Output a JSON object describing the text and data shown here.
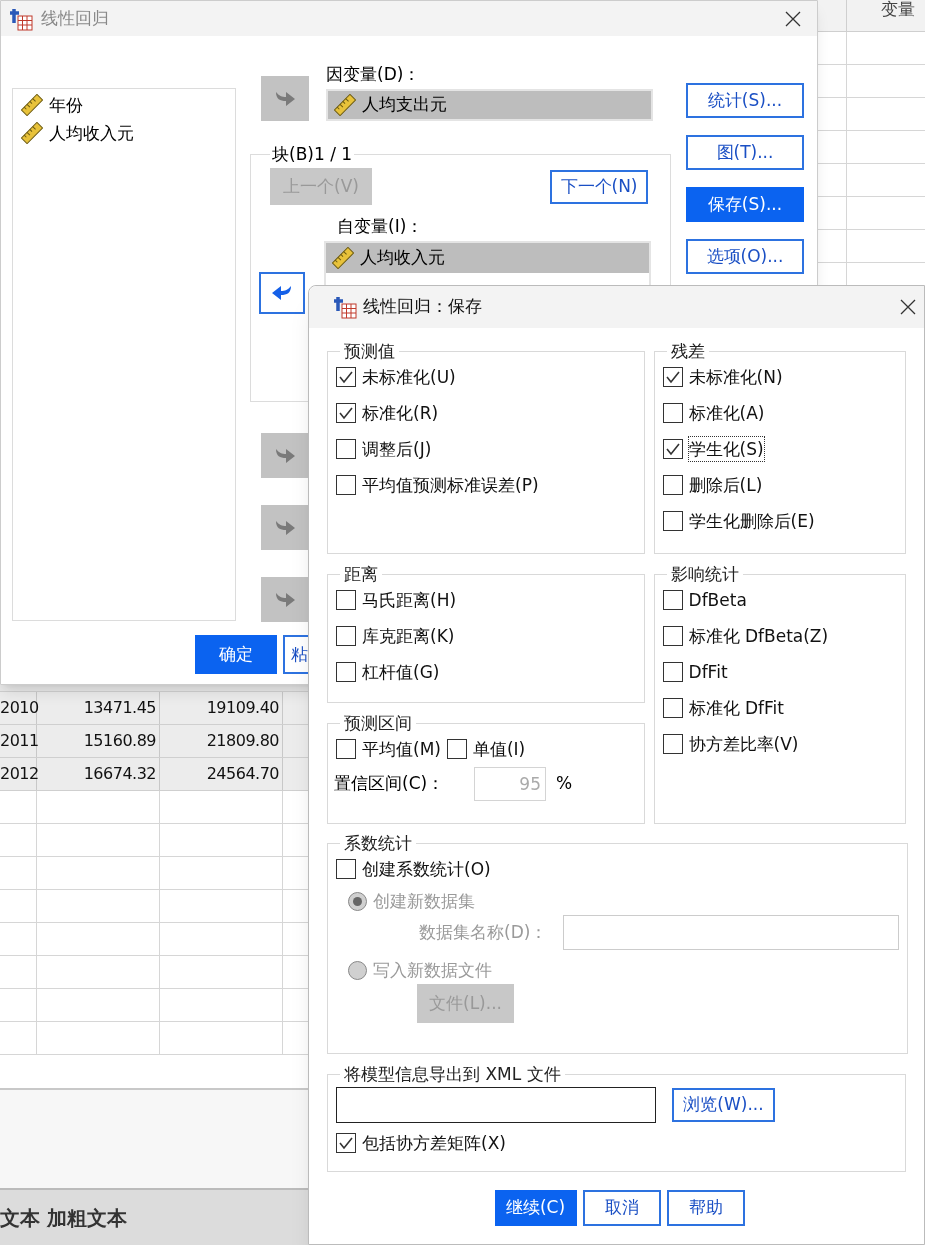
{
  "sheet_top": {
    "header": "变量"
  },
  "sheet": {
    "rows": [
      {
        "cells": [
          "2010",
          "13471.45",
          "19109.40"
        ]
      },
      {
        "cells": [
          "2011",
          "15160.89",
          "21809.80"
        ]
      },
      {
        "cells": [
          "2012",
          "16674.32",
          "24564.70"
        ]
      }
    ],
    "status_text": "文本 加粗文本"
  },
  "main_dialog": {
    "title": "线性回归",
    "variables": [
      "年份",
      "人均收入元"
    ],
    "dependent_label": "因变量(D)：",
    "dependent": [
      "人均支出元"
    ],
    "block_label": "块(B)1 / 1",
    "block_buttons": [
      {
        "label": "上一个(V)",
        "disabled": true
      },
      {
        "label": "下一个(N)",
        "disabled": false
      }
    ],
    "independent_label": "自变量(I)：",
    "independent": [
      "人均收入元"
    ],
    "side_buttons": [
      {
        "label": "统计(S)...",
        "selected": false
      },
      {
        "label": "图(T)...",
        "selected": false
      },
      {
        "label": "保存(S)...",
        "selected": true
      },
      {
        "label": "选项(O)...",
        "selected": false
      }
    ],
    "bottom_buttons": [
      {
        "label": "确定",
        "selected": true
      },
      {
        "label": "粘",
        "selected": false
      }
    ]
  },
  "save_dialog": {
    "title": "线性回归：保存",
    "predicted": {
      "title": "预测值",
      "items": [
        {
          "label": "未标准化(U)",
          "checked": true,
          "focused": false
        },
        {
          "label": "标准化(R)",
          "checked": true,
          "focused": false
        },
        {
          "label": "调整后(J)",
          "checked": false,
          "focused": false
        },
        {
          "label": "平均值预测标准误差(P)",
          "checked": false,
          "focused": false
        }
      ]
    },
    "distances": {
      "title": "距离",
      "items": [
        {
          "label": "马氏距离(H)",
          "checked": false,
          "focused": false
        },
        {
          "label": "库克距离(K)",
          "checked": false,
          "focused": false
        },
        {
          "label": "杠杆值(G)",
          "checked": false,
          "focused": false
        }
      ]
    },
    "interval": {
      "title": "预测区间",
      "items": [
        {
          "label": "平均值(M)",
          "checked": false,
          "focused": false
        },
        {
          "label": "单值(I)",
          "checked": false,
          "focused": false
        }
      ],
      "confidence": {
        "label": "置信区间(C)：",
        "value": "95",
        "disabled": true,
        "unit": "%"
      }
    },
    "residuals": {
      "title": "残差",
      "items": [
        {
          "label": "未标准化(N)",
          "checked": true,
          "focused": false
        },
        {
          "label": "标准化(A)",
          "checked": false,
          "focused": false
        },
        {
          "label": "学生化(S)",
          "checked": true,
          "focused": true
        },
        {
          "label": "删除后(L)",
          "checked": false,
          "focused": false
        },
        {
          "label": "学生化删除后(E)",
          "checked": false,
          "focused": false
        }
      ]
    },
    "influence": {
      "title": "影响统计",
      "items": [
        {
          "label": "DfBeta",
          "checked": false,
          "focused": false
        },
        {
          "label": "标准化 DfBeta(Z)",
          "checked": false,
          "focused": false
        },
        {
          "label": "DfFit",
          "checked": false,
          "focused": false
        },
        {
          "label": "标准化 DfFit",
          "checked": false,
          "focused": false
        },
        {
          "label": "协方差比率(V)",
          "checked": false,
          "focused": false
        }
      ]
    },
    "coefficients": {
      "title": "系数统计",
      "check": {
        "label": "创建系数统计(O)",
        "checked": false,
        "focused": false
      },
      "radios": [
        {
          "label": "创建新数据集",
          "selected": true,
          "disabled": true
        },
        {
          "label": "写入新数据文件",
          "selected": false,
          "disabled": true
        }
      ],
      "dataset_name": {
        "label": "数据集名称(D)：",
        "disabled": true
      },
      "file_button": {
        "label": "文件(L)...",
        "disabled": true
      }
    },
    "xml": {
      "title": "将模型信息导出到 XML 文件",
      "browse_button": "浏览(W)...",
      "include": {
        "label": "包括协方差矩阵(X)",
        "checked": true,
        "focused": false
      }
    },
    "buttons": [
      {
        "label": "继续(C)",
        "selected": true
      },
      {
        "label": "取消",
        "selected": false
      },
      {
        "label": "帮助",
        "selected": false
      }
    ]
  }
}
